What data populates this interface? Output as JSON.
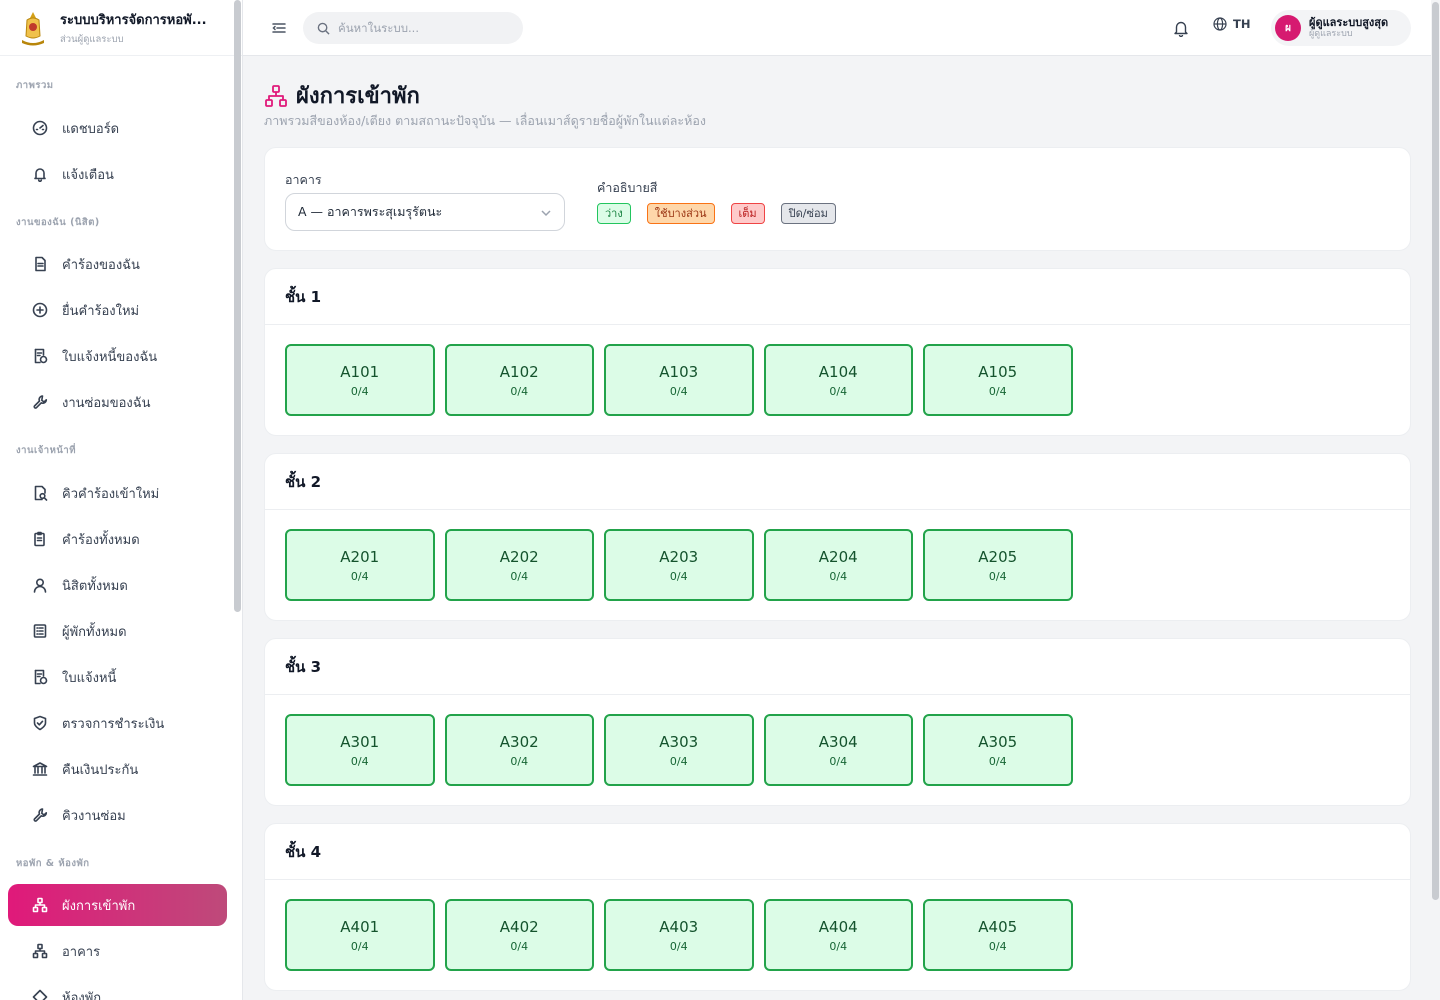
{
  "brand": {
    "title": "ระบบบริหารจัดการหอพั...",
    "subtitle": "ส่วนผู้ดูแลระบบ"
  },
  "sidebar": {
    "sections": [
      {
        "label": "ภาพรวม",
        "items": [
          {
            "label": "แดชบอร์ด",
            "icon": "dashboard-icon"
          },
          {
            "label": "แจ้งเตือน",
            "icon": "bell-icon"
          }
        ]
      },
      {
        "label": "งานของฉัน (นิสิต)",
        "items": [
          {
            "label": "คำร้องของฉัน",
            "icon": "document-icon"
          },
          {
            "label": "ยื่นคำร้องใหม่",
            "icon": "plus-circle-icon"
          },
          {
            "label": "ใบแจ้งหนี้ของฉัน",
            "icon": "invoice-icon"
          },
          {
            "label": "งานซ่อมของฉัน",
            "icon": "wrench-icon"
          }
        ]
      },
      {
        "label": "งานเจ้าหน้าที่",
        "items": [
          {
            "label": "คิวคำร้องเข้าใหม่",
            "icon": "document-search-icon"
          },
          {
            "label": "คำร้องทั้งหมด",
            "icon": "clipboard-icon"
          },
          {
            "label": "นิสิตทั้งหมด",
            "icon": "user-icon"
          },
          {
            "label": "ผู้พักทั้งหมด",
            "icon": "list-icon"
          },
          {
            "label": "ใบแจ้งหนี้",
            "icon": "invoice-icon"
          },
          {
            "label": "ตรวจการชำระเงิน",
            "icon": "shield-check-icon"
          },
          {
            "label": "คืนเงินประกัน",
            "icon": "bank-icon"
          },
          {
            "label": "คิวงานซ่อม",
            "icon": "wrench-icon"
          }
        ]
      },
      {
        "label": "หอพัก & ห้องพัก",
        "items": [
          {
            "label": "ผังการเข้าพัก",
            "icon": "sitemap-icon",
            "active": true
          },
          {
            "label": "อาคาร",
            "icon": "sitemap-icon"
          },
          {
            "label": "ห้องพัก",
            "icon": "diamond-icon"
          }
        ]
      }
    ]
  },
  "topbar": {
    "search_placeholder": "ค้นหาในระบบ...",
    "language": "TH",
    "user": {
      "initial": "ผ",
      "name": "ผู้ดูแลระบบสูงสุด",
      "role": "ผู้ดูแลระบบ"
    }
  },
  "page": {
    "title": "ผังการเข้าพัก",
    "description": "ภาพรวมสีของห้อง/เตียง ตามสถานะปัจจุบัน — เลื่อนเมาส์ดูรายชื่อผู้พักในแต่ละห้อง"
  },
  "filter": {
    "building_label": "อาคาร",
    "building_value": "A — อาคารพระสุเมรุรัตนะ",
    "legend_label": "คำอธิบายสี",
    "legend": [
      {
        "label": "ว่าง",
        "status": "free"
      },
      {
        "label": "ใช้บางส่วน",
        "status": "partial"
      },
      {
        "label": "เต็ม",
        "status": "full"
      },
      {
        "label": "ปิด/ซ่อม",
        "status": "closed"
      }
    ]
  },
  "floors": [
    {
      "label": "ชั้น 1",
      "rooms": [
        {
          "code": "A101",
          "occ": "0/4"
        },
        {
          "code": "A102",
          "occ": "0/4"
        },
        {
          "code": "A103",
          "occ": "0/4"
        },
        {
          "code": "A104",
          "occ": "0/4"
        },
        {
          "code": "A105",
          "occ": "0/4"
        }
      ]
    },
    {
      "label": "ชั้น 2",
      "rooms": [
        {
          "code": "A201",
          "occ": "0/4"
        },
        {
          "code": "A202",
          "occ": "0/4"
        },
        {
          "code": "A203",
          "occ": "0/4"
        },
        {
          "code": "A204",
          "occ": "0/4"
        },
        {
          "code": "A205",
          "occ": "0/4"
        }
      ]
    },
    {
      "label": "ชั้น 3",
      "rooms": [
        {
          "code": "A301",
          "occ": "0/4"
        },
        {
          "code": "A302",
          "occ": "0/4"
        },
        {
          "code": "A303",
          "occ": "0/4"
        },
        {
          "code": "A304",
          "occ": "0/4"
        },
        {
          "code": "A305",
          "occ": "0/4"
        }
      ]
    },
    {
      "label": "ชั้น 4",
      "rooms": [
        {
          "code": "A401",
          "occ": "0/4"
        },
        {
          "code": "A402",
          "occ": "0/4"
        },
        {
          "code": "A403",
          "occ": "0/4"
        },
        {
          "code": "A404",
          "occ": "0/4"
        },
        {
          "code": "A405",
          "occ": "0/4"
        }
      ]
    }
  ],
  "colors": {
    "accent": "#e0197a",
    "room_free_bg": "#dcfce7",
    "room_free_border": "#22a34a"
  }
}
